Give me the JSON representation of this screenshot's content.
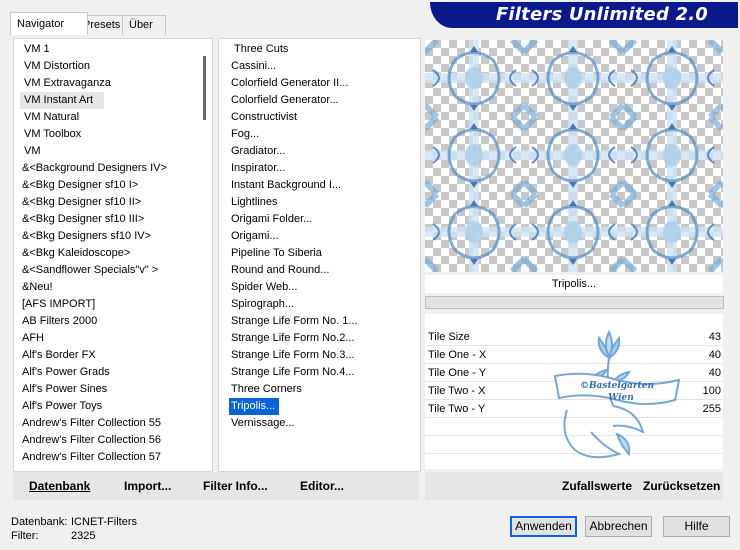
{
  "tabs": [
    "Navigator",
    "Presets",
    "Über"
  ],
  "banner_title": "Filters Unlimited 2.0",
  "categories": [
    "VM 1",
    "VM Distortion",
    "VM Extravaganza",
    "VM Instant Art",
    "VM Natural",
    "VM Toolbox",
    "VM",
    "&<Background Designers IV>",
    "&<Bkg Designer sf10 I>",
    "&<Bkg Designer sf10 II>",
    "&<Bkg Designer sf10 III>",
    "&<Bkg Designers sf10 IV>",
    "&<Bkg Kaleidoscope>",
    "&<Sandflower Specials\"v\" >",
    "&Neu!",
    "[AFS IMPORT]",
    "AB Filters 2000",
    "AFH",
    "Alf's Border FX",
    "Alf's Power Grads",
    "Alf's Power Sines",
    "Alf's Power Toys",
    "Andrew's Filter Collection 55",
    "Andrew's Filter Collection 56",
    "Andrew's Filter Collection 57"
  ],
  "filters": [
    "Three Cuts",
    "Cassini...",
    "Colorfield Generator II...",
    "Colorfield Generator...",
    "Constructivist",
    "Fog...",
    "Gradiator...",
    "Inspirator...",
    "Instant Background I...",
    "Lightlines",
    "Origami Folder...",
    "Origami...",
    "Pipeline To Siberia",
    "Round and Round...",
    "Spider Web...",
    "Spirograph...",
    "Strange Life Form No. 1...",
    "Strange Life Form No.2...",
    "Strange Life Form No.3...",
    "Strange Life Form No.4...",
    "Three Corners",
    "Tripolis...",
    "Vernissage..."
  ],
  "selected_filter": "Tripolis...",
  "params": [
    {
      "label": "Tile Size",
      "value": "43"
    },
    {
      "label": "Tile One - X",
      "value": "40"
    },
    {
      "label": "Tile One - Y",
      "value": "40"
    },
    {
      "label": "Tile Two - X",
      "value": "100"
    },
    {
      "label": "Tile Two - Y",
      "value": "255"
    }
  ],
  "buttons_left": [
    "Datenbank",
    "Import...",
    "Filter Info...",
    "Editor..."
  ],
  "buttons_right": [
    "Zufallswerte",
    "Zurücksetzen"
  ],
  "status": {
    "db_label": "Datenbank:",
    "db_value": "ICNET-Filters",
    "filter_label": "Filter:",
    "filter_value": "2325"
  },
  "dialog_buttons": [
    "Anwenden",
    "Abbrechen",
    "Hilfe"
  ],
  "watermark_lines": [
    "©Bastelgarten",
    "Wien"
  ],
  "colors": {
    "banner": "#0a1a8a",
    "selection": "#0a64d8"
  }
}
